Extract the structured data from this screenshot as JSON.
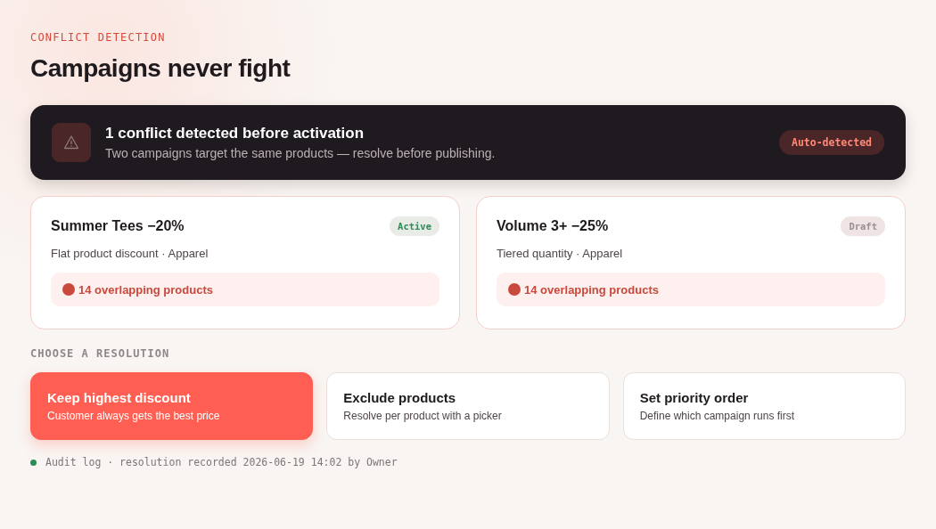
{
  "eyebrow": "CONFLICT DETECTION",
  "title": "Campaigns never fight",
  "alert": {
    "title": "1 conflict detected before activation",
    "message": "Two campaigns target the same products — resolve before publishing.",
    "badge": "Auto-detected"
  },
  "campaigns": [
    {
      "name": "Summer Tees −20%",
      "status": "Active",
      "kind": "active",
      "meta": "Flat product discount · Apparel",
      "overlap": "14 overlapping products",
      "color": "#c9493c"
    },
    {
      "name": "Volume 3+ −25%",
      "status": "Draft",
      "kind": "draft",
      "meta": "Tiered quantity · Apparel",
      "overlap": "14 overlapping products",
      "color": "#c9493c"
    }
  ],
  "resolution_label": "CHOOSE A RESOLUTION",
  "options": [
    {
      "title": "Keep highest discount",
      "description": "Customer always gets the best price",
      "selected": true
    },
    {
      "title": "Exclude products",
      "description": "Resolve per product with a picker",
      "selected": false
    },
    {
      "title": "Set priority order",
      "description": "Define which campaign runs first",
      "selected": false
    }
  ],
  "audit": {
    "text": "Audit log · resolution recorded 2026-06-19 14:02 by Owner",
    "color": "#2e8b57"
  }
}
